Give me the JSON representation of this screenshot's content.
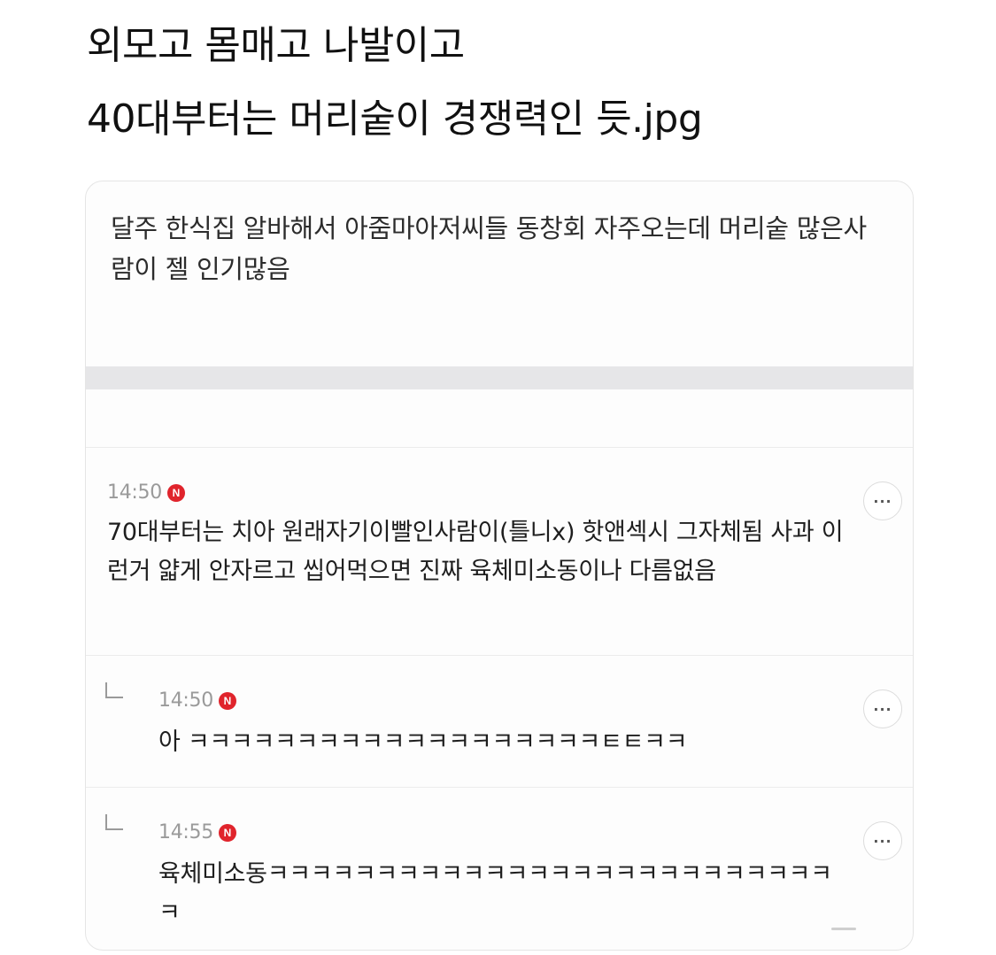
{
  "post": {
    "title_line1": "외모고 몸매고 나발이고",
    "title_line2": "40대부터는 머리숱이 경쟁력인 듯.jpg"
  },
  "card": {
    "body_text": "달주 한식집 알바해서 아줌마아저씨들 동창회 자주오는데 머리숱 많은사람이 젤 인기많음"
  },
  "comments": [
    {
      "time": "14:50",
      "badge": "N",
      "text": "70대부터는 치아 원래자기이빨인사람이(틀니x) 핫앤섹시 그자체됨 사과 이런거 얇게 안자르고 씹어먹으면 진짜 육체미소동이나 다름없음",
      "more_label": "···",
      "is_reply": false
    },
    {
      "time": "14:50",
      "badge": "N",
      "text": "아 ㅋㅋㅋㅋㅋㅋㅋㅋㅋㅋㅋㅋㅋㅋㅋㅋㅋㅋㅋㅌㅌㅋㅋ",
      "more_label": "···",
      "is_reply": true
    },
    {
      "time": "14:55",
      "badge": "N",
      "text": "육체미소동ㅋㅋㅋㅋㅋㅋㅋㅋㅋㅋㅋㅋㅋㅋㅋㅋㅋㅋㅋㅋㅋㅋㅋㅋㅋㅋㅋ",
      "more_label": "···",
      "is_reply": true
    }
  ],
  "colors": {
    "new_badge": "#e0242c",
    "time_text": "#9a9a9a",
    "divider": "#e6e6e8"
  },
  "icons": {
    "new_badge": "new-badge-icon",
    "more": "more-options-icon",
    "reply": "reply-arrow-icon"
  }
}
